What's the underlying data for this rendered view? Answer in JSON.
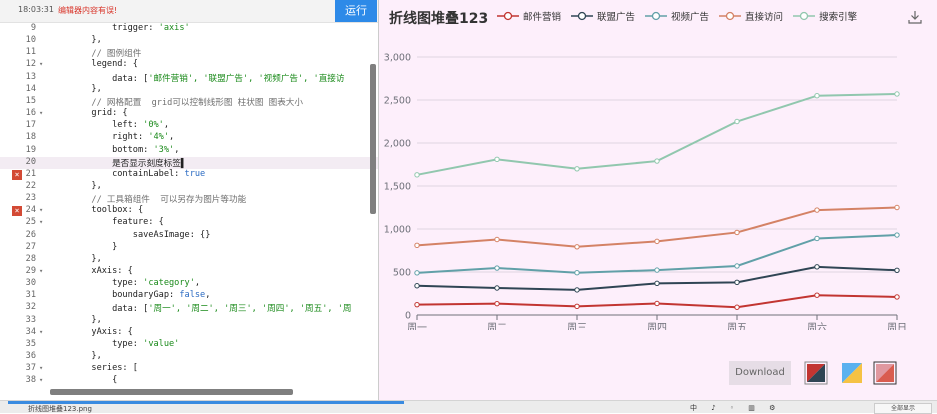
{
  "editor": {
    "time": "18:03:31",
    "warning": "编辑器内容有误!",
    "run_label": "运行",
    "lines": [
      {
        "num": "9",
        "fold": false,
        "err": false,
        "tokens": [
          {
            "t": "            trigger: ",
            "c": "k"
          },
          {
            "t": "'axis'",
            "c": "s"
          }
        ]
      },
      {
        "num": "10",
        "fold": false,
        "err": false,
        "tokens": [
          {
            "t": "        },",
            "c": "k"
          }
        ]
      },
      {
        "num": "11",
        "fold": false,
        "err": false,
        "tokens": [
          {
            "t": "        // 图例组件",
            "c": "c"
          }
        ]
      },
      {
        "num": "12",
        "fold": true,
        "err": false,
        "tokens": [
          {
            "t": "        legend: {",
            "c": "k"
          }
        ]
      },
      {
        "num": "13",
        "fold": false,
        "err": false,
        "tokens": [
          {
            "t": "            data: [",
            "c": "k"
          },
          {
            "t": "'邮件营销', '联盟广告', '视频广告', '直接访",
            "c": "s"
          }
        ]
      },
      {
        "num": "14",
        "fold": false,
        "err": false,
        "tokens": [
          {
            "t": "        },",
            "c": "k"
          }
        ]
      },
      {
        "num": "15",
        "fold": false,
        "err": false,
        "tokens": [
          {
            "t": "        // 网格配置  grid可以控制线形图 柱状图 图表大小",
            "c": "c"
          }
        ]
      },
      {
        "num": "16",
        "fold": true,
        "err": false,
        "tokens": [
          {
            "t": "        grid: {",
            "c": "k"
          }
        ]
      },
      {
        "num": "17",
        "fold": false,
        "err": false,
        "tokens": [
          {
            "t": "            left: ",
            "c": "k"
          },
          {
            "t": "'0%'",
            "c": "s"
          },
          {
            "t": ",",
            "c": "k"
          }
        ]
      },
      {
        "num": "18",
        "fold": false,
        "err": false,
        "tokens": [
          {
            "t": "            right: ",
            "c": "k"
          },
          {
            "t": "'4%'",
            "c": "s"
          },
          {
            "t": ",",
            "c": "k"
          }
        ]
      },
      {
        "num": "19",
        "fold": false,
        "err": false,
        "tokens": [
          {
            "t": "            bottom: ",
            "c": "k"
          },
          {
            "t": "'3%'",
            "c": "s"
          },
          {
            "t": ",",
            "c": "k"
          }
        ]
      },
      {
        "num": "20",
        "fold": false,
        "err": false,
        "hl": true,
        "tokens": [
          {
            "t": "            是否显示刻度标签▌",
            "c": "k"
          }
        ]
      },
      {
        "num": "21",
        "fold": false,
        "err": true,
        "tokens": [
          {
            "t": "            containLabel: ",
            "c": "k"
          },
          {
            "t": "true",
            "c": "b"
          }
        ]
      },
      {
        "num": "22",
        "fold": false,
        "err": false,
        "tokens": [
          {
            "t": "        },",
            "c": "k"
          }
        ]
      },
      {
        "num": "23",
        "fold": false,
        "err": false,
        "tokens": [
          {
            "t": "        // 工具箱组件  可以另存为图片等功能",
            "c": "c"
          }
        ]
      },
      {
        "num": "24",
        "fold": true,
        "err": true,
        "tokens": [
          {
            "t": "        toolbox: {",
            "c": "k"
          }
        ]
      },
      {
        "num": "25",
        "fold": true,
        "err": false,
        "tokens": [
          {
            "t": "            feature: {",
            "c": "k"
          }
        ]
      },
      {
        "num": "26",
        "fold": false,
        "err": false,
        "tokens": [
          {
            "t": "                saveAsImage: {}",
            "c": "k"
          }
        ]
      },
      {
        "num": "27",
        "fold": false,
        "err": false,
        "tokens": [
          {
            "t": "            }",
            "c": "k"
          }
        ]
      },
      {
        "num": "28",
        "fold": false,
        "err": false,
        "tokens": [
          {
            "t": "        },",
            "c": "k"
          }
        ]
      },
      {
        "num": "29",
        "fold": true,
        "err": false,
        "tokens": [
          {
            "t": "        xAxis: {",
            "c": "k"
          }
        ]
      },
      {
        "num": "30",
        "fold": false,
        "err": false,
        "tokens": [
          {
            "t": "            type: ",
            "c": "k"
          },
          {
            "t": "'category'",
            "c": "s"
          },
          {
            "t": ",",
            "c": "k"
          }
        ]
      },
      {
        "num": "31",
        "fold": false,
        "err": false,
        "tokens": [
          {
            "t": "            boundaryGap: ",
            "c": "k"
          },
          {
            "t": "false",
            "c": "b"
          },
          {
            "t": ",",
            "c": "k"
          }
        ]
      },
      {
        "num": "32",
        "fold": false,
        "err": false,
        "tokens": [
          {
            "t": "            data: [",
            "c": "k"
          },
          {
            "t": "'周一', '周二', '周三', '周四', '周五', '周",
            "c": "s"
          }
        ]
      },
      {
        "num": "33",
        "fold": false,
        "err": false,
        "tokens": [
          {
            "t": "        },",
            "c": "k"
          }
        ]
      },
      {
        "num": "34",
        "fold": true,
        "err": false,
        "tokens": [
          {
            "t": "        yAxis: {",
            "c": "k"
          }
        ]
      },
      {
        "num": "35",
        "fold": false,
        "err": false,
        "tokens": [
          {
            "t": "            type: ",
            "c": "k"
          },
          {
            "t": "'value'",
            "c": "s"
          }
        ]
      },
      {
        "num": "36",
        "fold": false,
        "err": false,
        "tokens": [
          {
            "t": "        },",
            "c": "k"
          }
        ]
      },
      {
        "num": "37",
        "fold": true,
        "err": false,
        "tokens": [
          {
            "t": "        series: [",
            "c": "k"
          }
        ]
      },
      {
        "num": "38",
        "fold": true,
        "err": false,
        "tokens": [
          {
            "t": "            {",
            "c": "k"
          }
        ]
      }
    ]
  },
  "preview": {
    "download_label": "Download",
    "colors": {
      "bg": "#fdeffb",
      "axis": "#6e7079",
      "grid": "#e0d6e0"
    }
  },
  "chart_data": {
    "type": "line",
    "title": "折线图堆叠123",
    "categories": [
      "周一",
      "周二",
      "周三",
      "周四",
      "周五",
      "周六",
      "周日"
    ],
    "ylim": [
      0,
      3000
    ],
    "yticks": [
      "0",
      "500",
      "1,000",
      "1,500",
      "2,000",
      "2,500",
      "3,000"
    ],
    "legend_position": "top",
    "grid": true,
    "series": [
      {
        "name": "邮件营销",
        "color": "#c23531",
        "values": [
          120,
          132,
          101,
          134,
          90,
          230,
          210
        ]
      },
      {
        "name": "联盟广告",
        "color": "#2f4554",
        "values": [
          340,
          314,
          292,
          368,
          380,
          560,
          520
        ]
      },
      {
        "name": "视频广告",
        "color": "#61a0a8",
        "values": [
          490,
          546,
          492,
          522,
          570,
          890,
          930
        ]
      },
      {
        "name": "直接访问",
        "color": "#d48265",
        "values": [
          810,
          878,
          793,
          856,
          960,
          1220,
          1250
        ]
      },
      {
        "name": "搜索引擎",
        "color": "#91c7ae",
        "values": [
          1630,
          1810,
          1700,
          1790,
          2250,
          2550,
          2570
        ]
      }
    ]
  },
  "statusbar": {
    "filename": "折线图堆叠123.png",
    "ime": "中 ♪ ◦ ▥ ⚙",
    "right_label": "全部显示"
  }
}
